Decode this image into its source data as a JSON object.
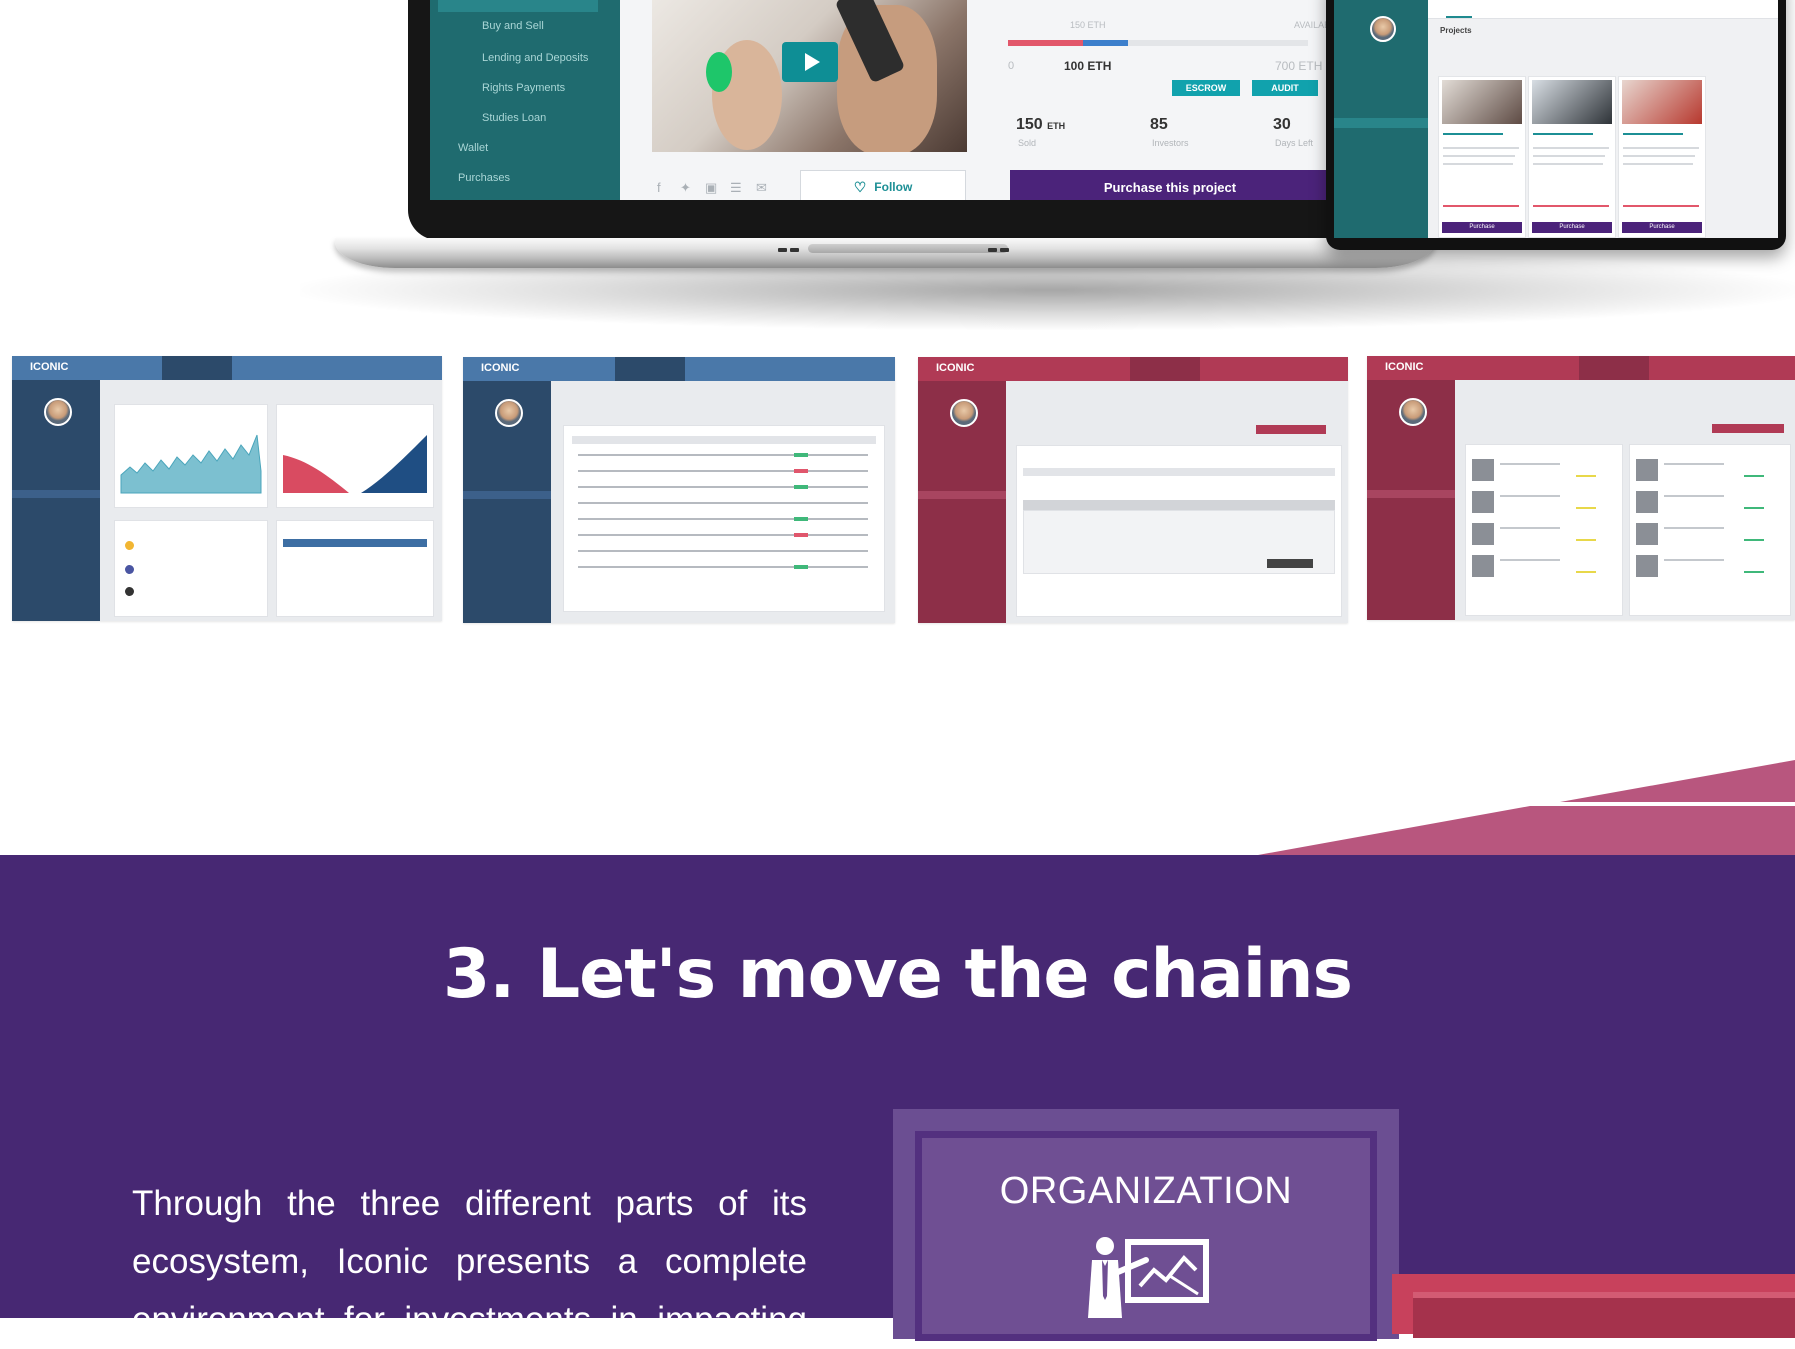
{
  "laptop": {
    "sidebar_items": [
      "Buy and Sell",
      "Lending and Deposits",
      "Rights Payments",
      "Studies Loan",
      "Wallet",
      "Purchases"
    ],
    "progress": {
      "funded_fraction": 0.25,
      "escrow_fraction": 0.15
    },
    "progress_top_labels": [
      "150 ETH",
      "AVAILABLE"
    ],
    "min_label": "0",
    "eth_amount": "100 ETH",
    "max_label": "700 ETH",
    "escrow_label": "ESCROW",
    "audit_label": "AUDIT",
    "stats": [
      {
        "value": "150",
        "unit": "ETH",
        "label": "Sold"
      },
      {
        "value": "85",
        "unit": "",
        "label": "Investors"
      },
      {
        "value": "30",
        "unit": "",
        "label": "Days Left"
      }
    ],
    "follow_label": "Follow",
    "purchase_label": "Purchase this project"
  },
  "tablet": {
    "section_title": "Projects",
    "card_button_label": "Purchase"
  },
  "thumbnails": [
    {
      "name": "trading-overview",
      "brand": "ICONIC",
      "bar_color": "#4a78a9",
      "side_color": "#2c4a6a"
    },
    {
      "name": "trading-orders",
      "brand": "ICONIC",
      "bar_color": "#4a78a9",
      "side_color": "#2c4a6a"
    },
    {
      "name": "audit-table",
      "brand": "ICONIC",
      "bar_color": "#b03a55",
      "side_color": "#8d2f48"
    },
    {
      "name": "audit-projects",
      "brand": "ICONIC",
      "bar_color": "#b03a55",
      "side_color": "#8d2f48"
    }
  ],
  "section": {
    "title": "3. Let's move the chains",
    "body": "Through the three different parts of its ecosystem, Iconic presents a complete environment for investments in impacting",
    "org_title": "ORGANIZATION",
    "colors": {
      "background": "#472873",
      "accent_pink": "#b8567e",
      "accent_red": "#c8415c"
    }
  }
}
